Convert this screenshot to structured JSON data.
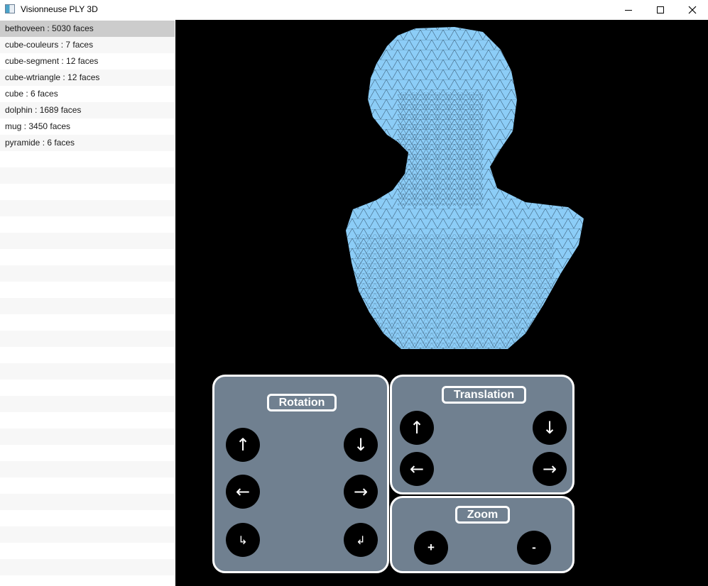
{
  "window": {
    "title": "Visionneuse PLY 3D"
  },
  "sidebar": {
    "items": [
      {
        "label": "bethoveen : 5030 faces"
      },
      {
        "label": "cube-couleurs : 7 faces"
      },
      {
        "label": "cube-segment : 12 faces"
      },
      {
        "label": "cube-wtriangle : 12 faces"
      },
      {
        "label": "cube : 6 faces"
      },
      {
        "label": "dolphin : 1689 faces"
      },
      {
        "label": "mug : 3450 faces"
      },
      {
        "label": "pyramide : 6 faces"
      }
    ],
    "selected_index": 0
  },
  "viewport": {
    "background": "#000000",
    "mesh_color": "#8ccdf7",
    "edge_color": "#3d5f7a"
  },
  "controls": {
    "panel_color": "#708090",
    "rotation": {
      "title": "Rotation",
      "up": "↑",
      "down": "↓",
      "left": "←",
      "right": "→",
      "rot_cw": "↳",
      "rot_ccw": "↲"
    },
    "translation": {
      "title": "Translation",
      "up": "↑",
      "down": "↓",
      "left": "←",
      "right": "→"
    },
    "zoom": {
      "title": "Zoom",
      "plus": "+",
      "minus": "-"
    }
  }
}
